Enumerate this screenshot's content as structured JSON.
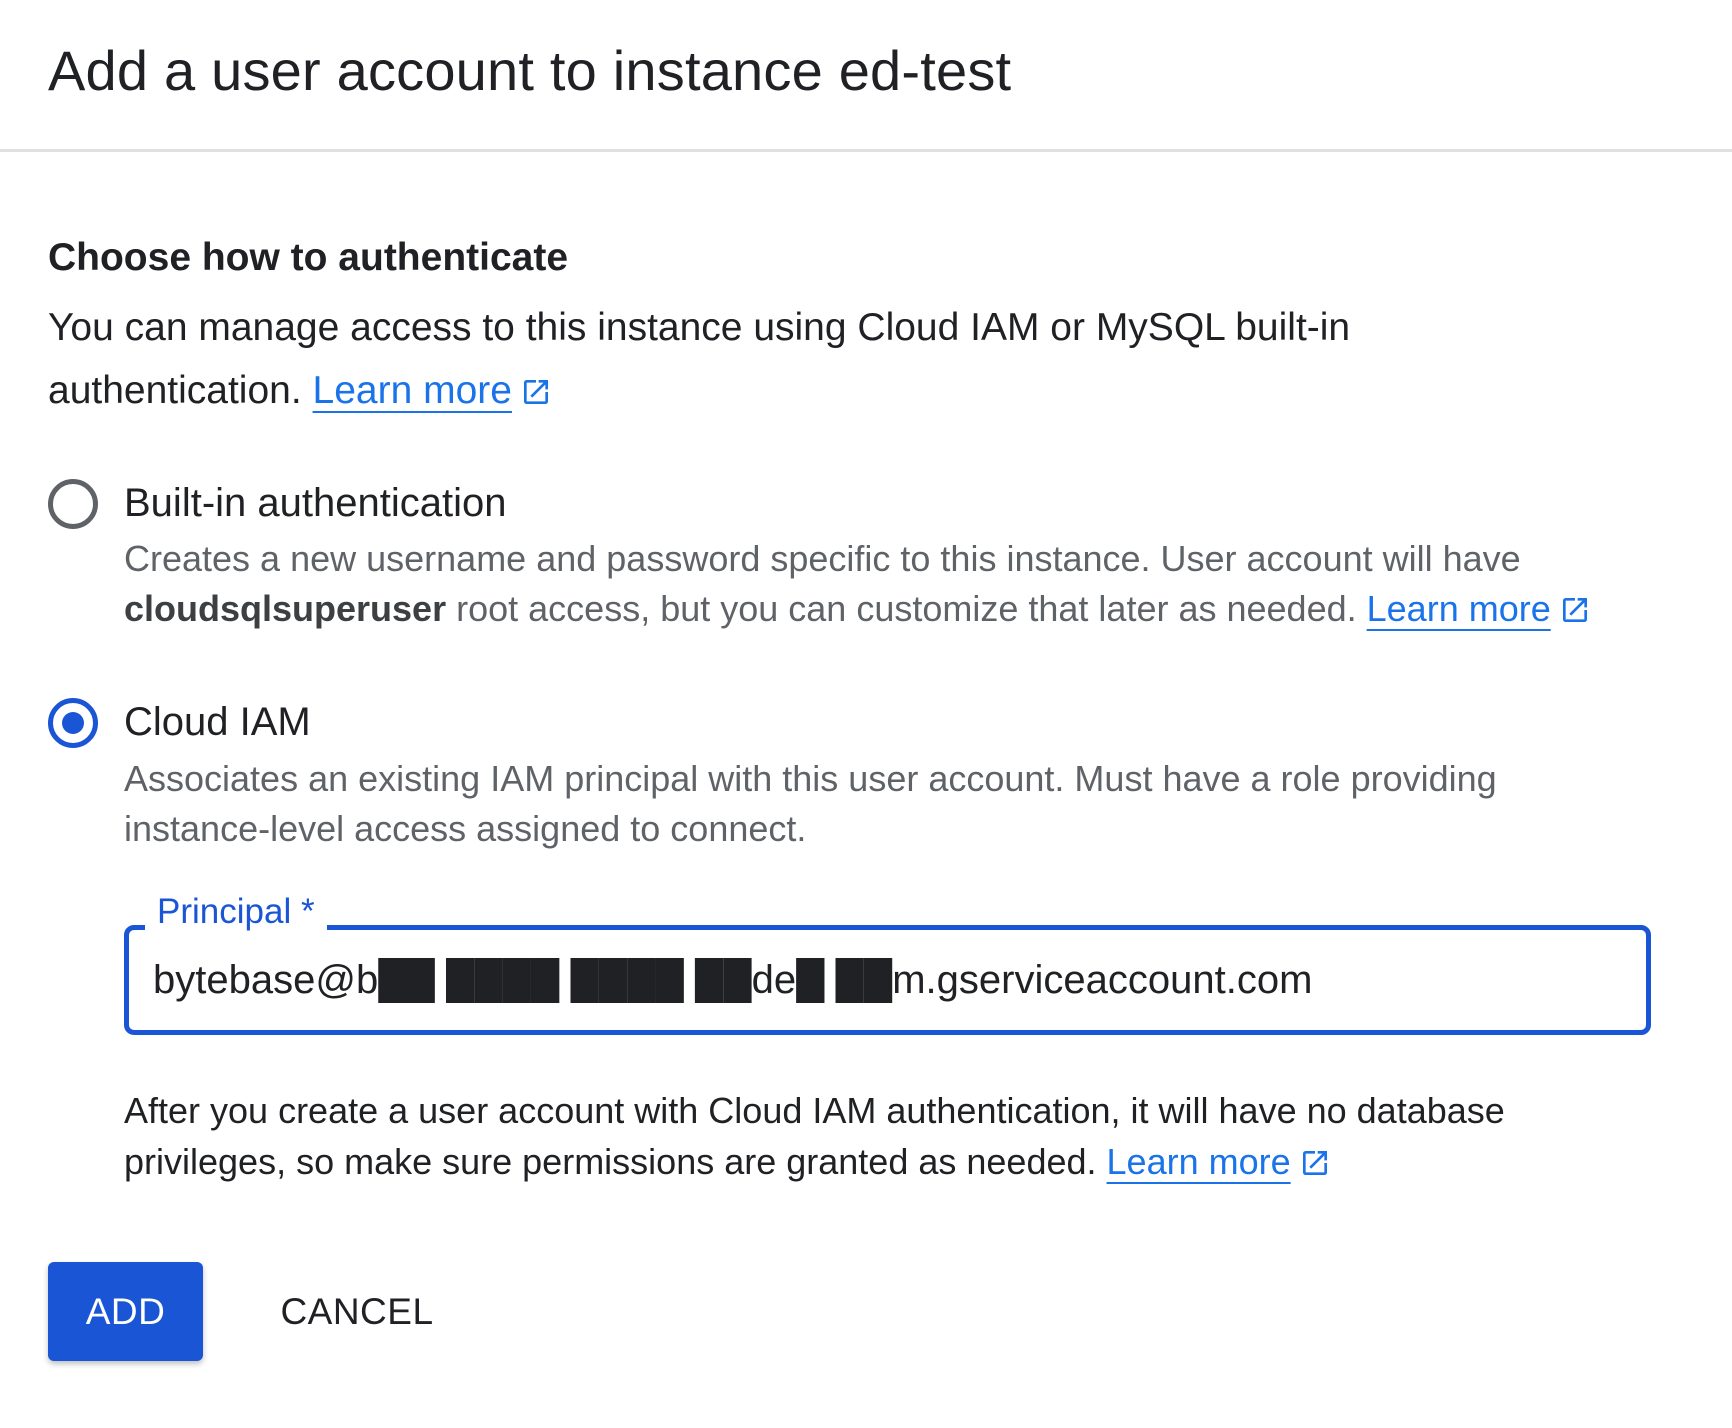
{
  "dialog": {
    "title": "Add a user account to instance ed-test"
  },
  "auth_section": {
    "heading": "Choose how to authenticate",
    "description": "You can manage access to this instance using Cloud IAM or MySQL built-in authentication.",
    "learn_more": "Learn more"
  },
  "options": {
    "builtin": {
      "label": "Built-in authentication",
      "selected": false,
      "desc_prefix": "Creates a new username and password specific to this instance. User account will have",
      "desc_bold": "cloudsqlsuperuser",
      "desc_suffix": "root access, but you can customize that later as needed.",
      "learn_more": "Learn more"
    },
    "cloud_iam": {
      "label": "Cloud IAM",
      "selected": true,
      "description": "Associates an existing IAM principal with this user account. Must have a role providing instance-level access assigned to connect."
    }
  },
  "principal_field": {
    "label": "Principal *",
    "value": "bytebase@b██ ████ ████ ██de█ ██m.gserviceaccount.com"
  },
  "note": {
    "text": "After you create a user account with Cloud IAM authentication, it will have no database privileges, so make sure permissions are granted as needed.",
    "learn_more": "Learn more"
  },
  "actions": {
    "add_label": "ADD",
    "cancel_label": "CANCEL"
  },
  "icons": {
    "external_link": "external-link-icon",
    "radio_unchecked": "radio-unchecked-icon",
    "radio_checked": "radio-checked-icon"
  },
  "colors": {
    "primary": "#1a55d6",
    "link": "#1a73e8",
    "text": "#202124",
    "secondary_text": "#5f6368",
    "divider": "#e0e0e0"
  }
}
